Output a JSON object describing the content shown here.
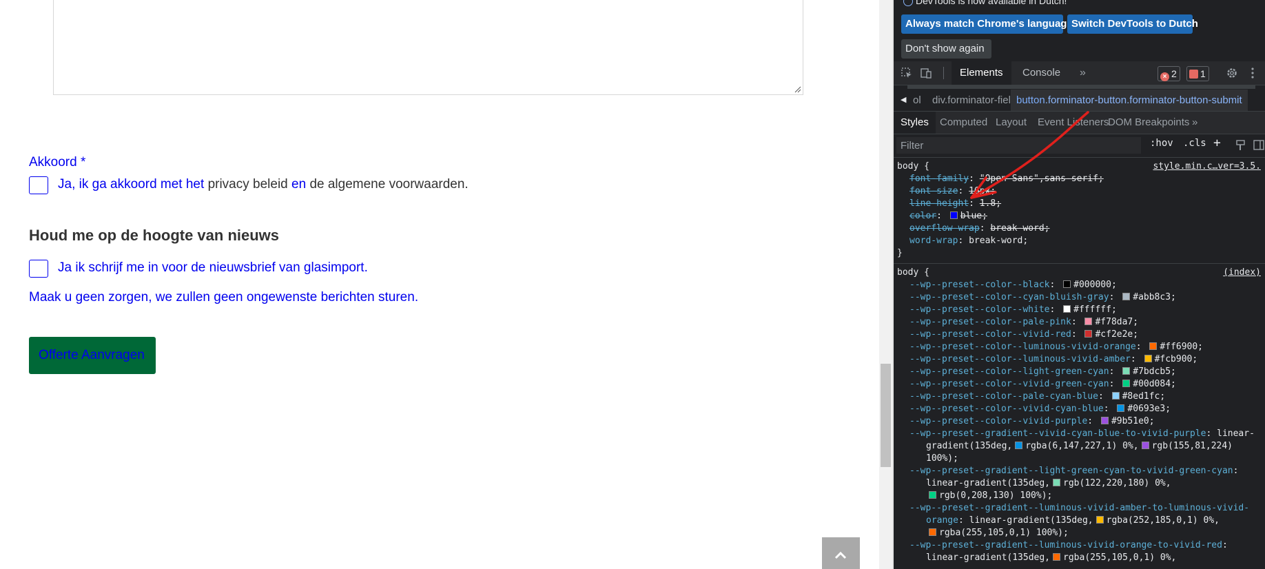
{
  "page": {
    "akkoord_label": "Akkoord *",
    "consent_part1": "Ja, ik ga akkoord met het ",
    "consent_privacy": "privacy beleid",
    "consent_en": " en ",
    "consent_terms": "de algemene voorwaarden.",
    "news_heading": "Houd me op de hoogte van nieuws",
    "newsletter_text": "Ja ik schrijf me in voor de nieuwsbrief van glasimport.",
    "reassure_text": "Maak u geen zorgen, we zullen geen ongewenste berichten sturen.",
    "submit_label": "Offerte Aanvragen"
  },
  "devtools": {
    "info_message": "DevTools is now available in Dutch!",
    "btn_match_language": "Always match Chrome's language",
    "btn_switch_dutch": "Switch DevTools to Dutch",
    "btn_dont_show": "Don't show again",
    "tab_elements": "Elements",
    "tab_console": "Console",
    "tab_more": "»",
    "errors_count": "2",
    "issues_count": "1",
    "breadcrumb_0": "ol",
    "breadcrumb_1": "div.forminator-field",
    "breadcrumb_2_tag": "button",
    "breadcrumb_2_class": ".forminator-button.forminator-button-submit",
    "subtabs": [
      "Styles",
      "Computed",
      "Layout",
      "Event Listeners",
      "DOM Breakpoints",
      "»"
    ],
    "filter_placeholder": "Filter",
    "hov_label": ":hov",
    "cls_label": ".cls",
    "plus_label": "+",
    "rule1": {
      "selector": "body {",
      "source": "style.min.c…ver=3.5.",
      "props": [
        {
          "name": "font-family",
          "value": "\"Open Sans\",sans-serif;",
          "struck": true
        },
        {
          "name": "font-size",
          "value": "16px;",
          "struck": true
        },
        {
          "name": "line-height",
          "value": "1.8;",
          "struck": true
        },
        {
          "name": "color",
          "value": "blue;",
          "struck": true,
          "swatch": "#0000ff"
        },
        {
          "name": "overflow-wrap",
          "value": "break-word;",
          "struck": true
        },
        {
          "name": "word-wrap",
          "value": "break-word;",
          "struck": false
        }
      ],
      "close": "}"
    },
    "rule2": {
      "selector": "body {",
      "source": "(index)",
      "props": [
        {
          "name": "--wp--preset--color--black",
          "value": "#000000;",
          "swatch": "#000000"
        },
        {
          "name": "--wp--preset--color--cyan-bluish-gray",
          "value": "#abb8c3;",
          "swatch": "#abb8c3"
        },
        {
          "name": "--wp--preset--color--white",
          "value": "#ffffff;",
          "swatch": "#ffffff"
        },
        {
          "name": "--wp--preset--color--pale-pink",
          "value": "#f78da7;",
          "swatch": "#f78da7"
        },
        {
          "name": "--wp--preset--color--vivid-red",
          "value": "#cf2e2e;",
          "swatch": "#cf2e2e"
        },
        {
          "name": "--wp--preset--color--luminous-vivid-orange",
          "value": "#ff6900;",
          "swatch": "#ff6900"
        },
        {
          "name": "--wp--preset--color--luminous-vivid-amber",
          "value": "#fcb900;",
          "swatch": "#fcb900"
        },
        {
          "name": "--wp--preset--color--light-green-cyan",
          "value": "#7bdcb5;",
          "swatch": "#7bdcb5"
        },
        {
          "name": "--wp--preset--color--vivid-green-cyan",
          "value": "#00d084;",
          "swatch": "#00d084"
        },
        {
          "name": "--wp--preset--color--pale-cyan-blue",
          "value": "#8ed1fc;",
          "swatch": "#8ed1fc"
        },
        {
          "name": "--wp--preset--color--vivid-cyan-blue",
          "value": "#0693e3;",
          "swatch": "#0693e3"
        },
        {
          "name": "--wp--preset--color--vivid-purple",
          "value": "#9b51e0;",
          "swatch": "#9b51e0"
        }
      ],
      "gradients": [
        {
          "name": "--wp--preset--gradient--vivid-cyan-blue-to-vivid-purple",
          "line1_suffix": " linear-",
          "line2": "gradient(135deg,",
          "sw1": "#0693e3",
          "v1": "rgba(6,147,227,1) 0%,",
          "sw2": "#9b51e0",
          "v2": "rgb(155,81,224)",
          "line3": "100%);"
        },
        {
          "name": "--wp--preset--gradient--light-green-cyan-to-vivid-green-cyan",
          "line2": "linear-gradient(135deg,",
          "sw1": "#7bdcb5",
          "v1": "rgb(122,220,180) 0%,",
          "sw2": "#00d084",
          "v2": "rgb(0,208,130) 100%);"
        },
        {
          "name": "--wp--preset--gradient--luminous-vivid-amber-to-luminous-vivid-",
          "cont": "orange",
          "line2": "linear-gradient(135deg,",
          "sw1": "#fcb900",
          "v1": "rgba(252,185,0,1) 0%,",
          "sw2": "#ff6900",
          "v2": "rgba(255,105,0,1) 100%);"
        },
        {
          "name": "--wp--preset--gradient--luminous-vivid-orange-to-vivid-red",
          "line2": "linear-gradient(135deg,",
          "sw1": "#ff6900",
          "v1": "rgba(255,105,0,1) 0%,"
        }
      ]
    }
  },
  "colors": {
    "link_blue": "#0000ee",
    "button_green": "#006837",
    "devtools_bg": "#202124",
    "devtools_blue_btn": "#1f6ab5",
    "annotation_arrow": "#e0201c"
  }
}
